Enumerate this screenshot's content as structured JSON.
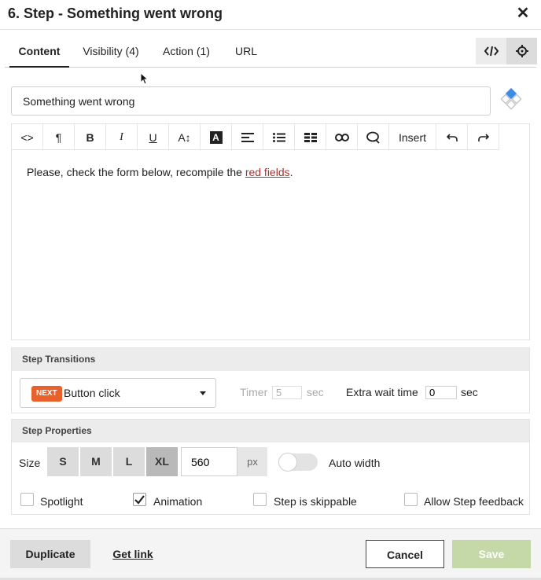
{
  "header": {
    "title": "6. Step - Something went wrong"
  },
  "tabs": [
    {
      "label": "Content"
    },
    {
      "label": "Visibility (4)"
    },
    {
      "label": "Action (1)"
    },
    {
      "label": "URL"
    }
  ],
  "step_title_value": "Something went wrong",
  "editor": {
    "toolbar": {
      "code": "<>",
      "paragraph": "¶",
      "bold": "B",
      "italic": "I",
      "underline": "U",
      "font_size": "A↕",
      "color": "A",
      "insert": "Insert"
    },
    "body_text": "Please, check the form below, recompile the ",
    "body_link": "red fields",
    "body_end": "."
  },
  "transitions": {
    "title": "Step Transitions",
    "badge": "NEXT",
    "selected": "Button click",
    "timer_label": "Timer",
    "timer_value": "5",
    "timer_unit": "sec",
    "extra_label": "Extra wait time",
    "extra_value": "0",
    "extra_unit": "sec"
  },
  "properties": {
    "title": "Step Properties",
    "size_label": "Size",
    "sizes": [
      "S",
      "M",
      "L",
      "XL"
    ],
    "selected_size": "XL",
    "width_value": "560",
    "width_unit": "px",
    "auto_width_label": "Auto width",
    "auto_width": false,
    "spotlight_label": "Spotlight",
    "spotlight": false,
    "animation_label": "Animation",
    "animation": true,
    "skippable_label": "Step is skippable",
    "skippable": false,
    "feedback_label": "Allow Step feedback",
    "feedback": false
  },
  "footer": {
    "duplicate": "Duplicate",
    "get_link": "Get link",
    "cancel": "Cancel",
    "save": "Save"
  },
  "colors": {
    "badge": "#e8602c",
    "link": "#a8342f",
    "save_disabled": "#c5d9a8",
    "accent_blue": "#3a8ee6"
  }
}
